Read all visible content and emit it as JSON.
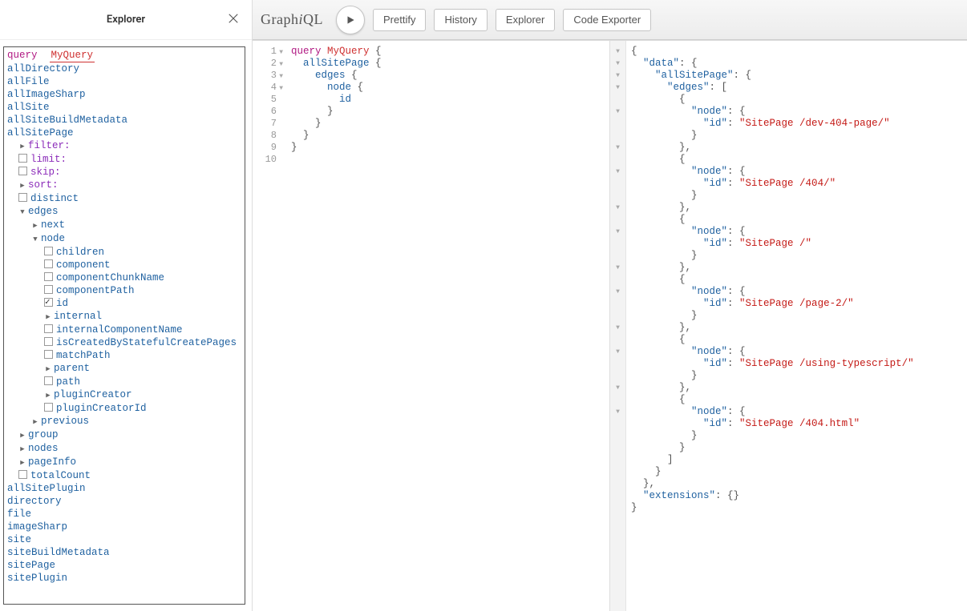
{
  "explorer": {
    "title": "Explorer",
    "query_keyword": "query",
    "query_name": "MyQuery",
    "roots": [
      "allDirectory",
      "allFile",
      "allImageSharp",
      "allSite",
      "allSiteBuildMetadata",
      "allSitePage",
      "allSitePlugin",
      "directory",
      "file",
      "imageSharp",
      "site",
      "siteBuildMetadata",
      "sitePage",
      "sitePlugin"
    ],
    "args": {
      "filter": "filter:",
      "limit": "limit:",
      "skip": "skip:",
      "sort": "sort:"
    },
    "selections": {
      "distinct": "distinct",
      "edges": "edges",
      "next": "next",
      "node": "node",
      "previous": "previous",
      "group": "group",
      "nodes": "nodes",
      "pageInfo": "pageInfo",
      "totalCount": "totalCount"
    },
    "node_fields": {
      "children": "children",
      "component": "component",
      "componentChunkName": "componentChunkName",
      "componentPath": "componentPath",
      "id": "id",
      "internal": "internal",
      "internalComponentName": "internalComponentName",
      "isCreatedByStatefulCreatePages": "isCreatedByStatefulCreatePages",
      "matchPath": "matchPath",
      "parent": "parent",
      "path": "path",
      "pluginCreator": "pluginCreator",
      "pluginCreatorId": "pluginCreatorId"
    }
  },
  "toolbar": {
    "logo_pre": "Graph",
    "logo_italic": "i",
    "logo_post": "QL",
    "prettify": "Prettify",
    "history": "History",
    "explorer": "Explorer",
    "code_exporter": "Code Exporter"
  },
  "editor": {
    "lines": [
      {
        "n": "1",
        "fold": "down",
        "tokens": [
          {
            "t": "query ",
            "c": "tok-kw"
          },
          {
            "t": "MyQuery ",
            "c": "tok-def"
          },
          {
            "t": "{",
            "c": "tok-brace"
          }
        ]
      },
      {
        "n": "2",
        "fold": "down",
        "tokens": [
          {
            "t": "  "
          },
          {
            "t": "allSitePage ",
            "c": "tok-field"
          },
          {
            "t": "{",
            "c": "tok-brace"
          }
        ]
      },
      {
        "n": "3",
        "fold": "down",
        "tokens": [
          {
            "t": "    "
          },
          {
            "t": "edges ",
            "c": "tok-field"
          },
          {
            "t": "{",
            "c": "tok-brace"
          }
        ]
      },
      {
        "n": "4",
        "fold": "down",
        "tokens": [
          {
            "t": "      "
          },
          {
            "t": "node ",
            "c": "tok-field"
          },
          {
            "t": "{",
            "c": "tok-brace"
          }
        ]
      },
      {
        "n": "5",
        "tokens": [
          {
            "t": "        "
          },
          {
            "t": "id",
            "c": "tok-field"
          }
        ]
      },
      {
        "n": "6",
        "tokens": [
          {
            "t": "      "
          },
          {
            "t": "}",
            "c": "tok-brace"
          }
        ]
      },
      {
        "n": "7",
        "tokens": [
          {
            "t": "    "
          },
          {
            "t": "}",
            "c": "tok-brace"
          }
        ]
      },
      {
        "n": "8",
        "tokens": [
          {
            "t": "  "
          },
          {
            "t": "}",
            "c": "tok-brace"
          }
        ]
      },
      {
        "n": "9",
        "tokens": [
          {
            "t": "}",
            "c": "tok-brace"
          }
        ]
      },
      {
        "n": "10",
        "tokens": [
          {
            "t": ""
          }
        ]
      }
    ]
  },
  "result": {
    "data_key": "data",
    "allSitePage_key": "allSitePage",
    "edges_key": "edges",
    "node_key": "node",
    "id_key": "id",
    "extensions_key": "extensions",
    "ids": [
      "SitePage /dev-404-page/",
      "SitePage /404/",
      "SitePage /",
      "SitePage /page-2/",
      "SitePage /using-typescript/",
      "SitePage /404.html"
    ],
    "folds": [
      true,
      true,
      true,
      true,
      false,
      true,
      false,
      false,
      true,
      false,
      true,
      false,
      false,
      true,
      false,
      true,
      false,
      false,
      true,
      false,
      true,
      false,
      false,
      true,
      false,
      true,
      false,
      false,
      true,
      false,
      true
    ]
  }
}
